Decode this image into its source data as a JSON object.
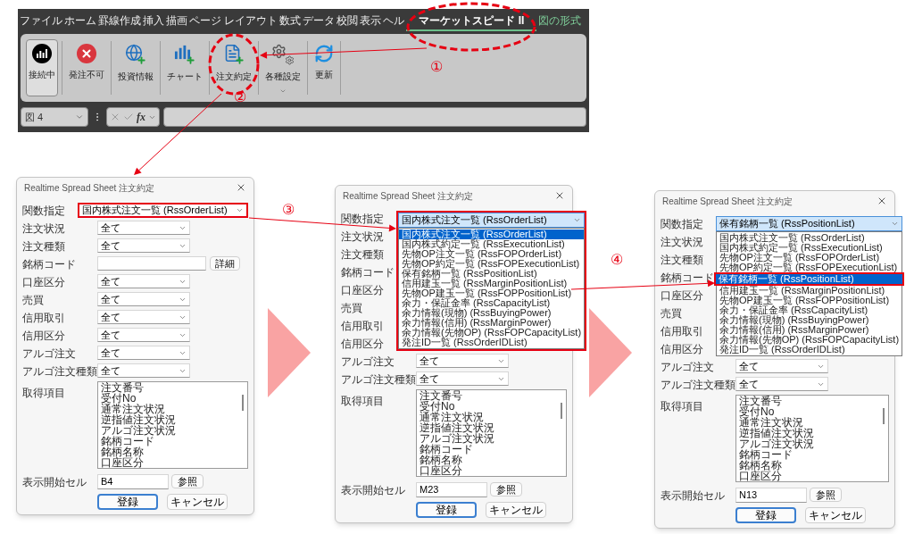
{
  "ribbon": {
    "tabs": [
      {
        "label": "ファイル",
        "selected": false,
        "kind": "normal"
      },
      {
        "label": "ホーム",
        "selected": false,
        "kind": "normal"
      },
      {
        "label": "罫線作成",
        "selected": false,
        "kind": "normal"
      },
      {
        "label": "挿入",
        "selected": false,
        "kind": "normal"
      },
      {
        "label": "描画",
        "selected": false,
        "kind": "normal"
      },
      {
        "label": "ページ レイアウト",
        "selected": false,
        "kind": "normal"
      },
      {
        "label": "数式",
        "selected": false,
        "kind": "normal"
      },
      {
        "label": "データ",
        "selected": false,
        "kind": "normal"
      },
      {
        "label": "校閲",
        "selected": false,
        "kind": "normal"
      },
      {
        "label": "表示",
        "selected": false,
        "kind": "normal"
      },
      {
        "label": "ヘル",
        "selected": false,
        "kind": "normal"
      },
      {
        "label": "マーケットスピード II",
        "selected": true,
        "kind": "normal"
      },
      {
        "label": "図の形式",
        "selected": false,
        "kind": "contextual"
      }
    ],
    "buttons": [
      {
        "label": "接続中",
        "kind": "connect",
        "pressed": true,
        "menu": false
      },
      {
        "label": "発注不可",
        "kind": "stop",
        "pressed": false,
        "menu": false
      },
      {
        "label": "投資情報",
        "kind": "globe",
        "pressed": false,
        "menu": false
      },
      {
        "label": "チャート",
        "kind": "chart",
        "pressed": false,
        "menu": false
      },
      {
        "label": "注文約定",
        "kind": "order",
        "pressed": false,
        "menu": false
      },
      {
        "label": "各種設定",
        "kind": "gears",
        "pressed": false,
        "menu": true
      },
      {
        "label": "更新",
        "kind": "refresh",
        "pressed": false,
        "menu": false
      }
    ]
  },
  "formula_bar": {
    "name_box": "図 4",
    "function_label": "fx"
  },
  "dialogs": [
    {
      "title": "Realtime Spread Sheet 注文約定",
      "function": {
        "label": "関数指定",
        "value": "国内株式注文一覧 (RssOrderList)",
        "focused": false,
        "highlighted": true,
        "list_highlighted": false
      },
      "fields": [
        {
          "label": "注文状況",
          "kind": "select",
          "value": "全て"
        },
        {
          "label": "注文種類",
          "kind": "select",
          "value": "全て"
        },
        {
          "label": "銘柄コード",
          "kind": "text",
          "button": "詳細"
        },
        {
          "label": "口座区分",
          "kind": "select",
          "value": "全て"
        },
        {
          "label": "売買",
          "kind": "select",
          "value": "全て"
        },
        {
          "label": "信用取引",
          "kind": "select",
          "value": "全て"
        },
        {
          "label": "信用区分",
          "kind": "select",
          "value": "全て"
        },
        {
          "label": "アルゴ注文",
          "kind": "select",
          "value": "全て"
        },
        {
          "label": "アルゴ注文種類",
          "kind": "select",
          "value": "全て"
        }
      ],
      "items_label": "取得項目",
      "items": [
        "注文番号",
        "受付No",
        "通常注文状況",
        "逆指値注文状況",
        "アルゴ注文状況",
        "銘柄コード",
        "銘柄名称",
        "口座区分"
      ],
      "start_cell": {
        "label": "表示開始セル",
        "value": "B4",
        "button": "参照"
      },
      "buttons": [
        {
          "label": "登録",
          "default": true
        },
        {
          "label": "キャンセル",
          "default": false
        }
      ]
    },
    {
      "title": "Realtime Spread Sheet 注文約定",
      "function": {
        "label": "関数指定",
        "value": "国内株式注文一覧 (RssOrderList)",
        "focused": true,
        "highlighted": false,
        "list_highlighted": true,
        "options": [
          {
            "label": "国内株式注文一覧 (RssOrderList)",
            "selected": true,
            "highlighted": false
          },
          {
            "label": "国内株式約定一覧 (RssExecutionList)",
            "selected": false,
            "highlighted": false
          },
          {
            "label": "先物OP注文一覧 (RssFOPOrderList)",
            "selected": false,
            "highlighted": false
          },
          {
            "label": "先物OP約定一覧 (RssFOPExecutionList)",
            "selected": false,
            "highlighted": false
          },
          {
            "label": "保有銘柄一覧 (RssPositionList)",
            "selected": false,
            "highlighted": false
          },
          {
            "label": "信用建玉一覧 (RssMarginPositionList)",
            "selected": false,
            "highlighted": false
          },
          {
            "label": "先物OP建玉一覧 (RssFOPPositionList)",
            "selected": false,
            "highlighted": false
          },
          {
            "label": "余力・保証金率 (RssCapacityList)",
            "selected": false,
            "highlighted": false
          },
          {
            "label": "余力情報(現物) (RssBuyingPower)",
            "selected": false,
            "highlighted": false
          },
          {
            "label": "余力情報(信用) (RssMarginPower)",
            "selected": false,
            "highlighted": false
          },
          {
            "label": "余力情報(先物OP) (RssFOPCapacityList)",
            "selected": false,
            "highlighted": false
          },
          {
            "label": "発注ID一覧 (RssOrderIDList)",
            "selected": false,
            "highlighted": false
          }
        ]
      },
      "fields": [
        {
          "label": "注文状況",
          "kind": "covered"
        },
        {
          "label": "注文種類",
          "kind": "covered"
        },
        {
          "label": "銘柄コード",
          "kind": "covered"
        },
        {
          "label": "口座区分",
          "kind": "covered"
        },
        {
          "label": "売買",
          "kind": "covered"
        },
        {
          "label": "信用取引",
          "kind": "covered"
        },
        {
          "label": "信用区分",
          "kind": "covered"
        },
        {
          "label": "アルゴ注文",
          "kind": "select",
          "value": "全て"
        },
        {
          "label": "アルゴ注文種類",
          "kind": "select",
          "value": "全て"
        }
      ],
      "items_label": "取得項目",
      "items": [
        "注文番号",
        "受付No",
        "通常注文状況",
        "逆指値注文状況",
        "アルゴ注文状況",
        "銘柄コード",
        "銘柄名称",
        "口座区分"
      ],
      "start_cell": {
        "label": "表示開始セル",
        "value": "M23",
        "button": "参照"
      },
      "buttons": [
        {
          "label": "登録",
          "default": true
        },
        {
          "label": "キャンセル",
          "default": false
        }
      ]
    },
    {
      "title": "Realtime Spread Sheet 注文約定",
      "function": {
        "label": "関数指定",
        "value": "保有銘柄一覧 (RssPositionList)",
        "focused": true,
        "highlighted": false,
        "list_highlighted": false,
        "options": [
          {
            "label": "国内株式注文一覧 (RssOrderList)",
            "selected": false,
            "highlighted": false
          },
          {
            "label": "国内株式約定一覧 (RssExecutionList)",
            "selected": false,
            "highlighted": false
          },
          {
            "label": "先物OP注文一覧 (RssFOPOrderList)",
            "selected": false,
            "highlighted": false
          },
          {
            "label": "先物OP約定一覧 (RssFOPExecutionList)",
            "selected": false,
            "highlighted": false
          },
          {
            "label": "保有銘柄一覧 (RssPositionList)",
            "selected": true,
            "highlighted": true
          },
          {
            "label": "信用建玉一覧 (RssMarginPositionList)",
            "selected": false,
            "highlighted": false
          },
          {
            "label": "先物OP建玉一覧 (RssFOPPositionList)",
            "selected": false,
            "highlighted": false
          },
          {
            "label": "余力・保証金率 (RssCapacityList)",
            "selected": false,
            "highlighted": false
          },
          {
            "label": "余力情報(現物) (RssBuyingPower)",
            "selected": false,
            "highlighted": false
          },
          {
            "label": "余力情報(信用) (RssMarginPower)",
            "selected": false,
            "highlighted": false
          },
          {
            "label": "余力情報(先物OP) (RssFOPCapacityList)",
            "selected": false,
            "highlighted": false
          },
          {
            "label": "発注ID一覧 (RssOrderIDList)",
            "selected": false,
            "highlighted": false
          }
        ]
      },
      "fields": [
        {
          "label": "注文状況",
          "kind": "covered"
        },
        {
          "label": "注文種類",
          "kind": "covered"
        },
        {
          "label": "銘柄コード",
          "kind": "covered"
        },
        {
          "label": "口座区分",
          "kind": "covered"
        },
        {
          "label": "売買",
          "kind": "covered"
        },
        {
          "label": "信用取引",
          "kind": "covered"
        },
        {
          "label": "信用区分",
          "kind": "covered"
        },
        {
          "label": "アルゴ注文",
          "kind": "select",
          "value": "全て"
        },
        {
          "label": "アルゴ注文種類",
          "kind": "select",
          "value": "全て"
        }
      ],
      "items_label": "取得項目",
      "items": [
        "注文番号",
        "受付No",
        "通常注文状況",
        "逆指値注文状況",
        "アルゴ注文状況",
        "銘柄コード",
        "銘柄名称",
        "口座区分"
      ],
      "start_cell": {
        "label": "表示開始セル",
        "value": "N13",
        "button": "参照"
      },
      "buttons": [
        {
          "label": "登録",
          "default": true
        },
        {
          "label": "キャンセル",
          "default": false
        }
      ]
    }
  ],
  "annotations": [
    {
      "label": "①"
    },
    {
      "label": "②"
    },
    {
      "label": "③"
    },
    {
      "label": "④"
    }
  ]
}
